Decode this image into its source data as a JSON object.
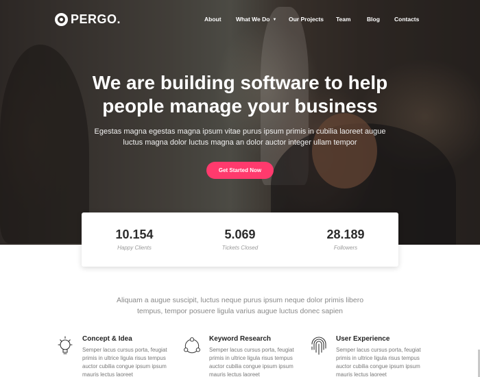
{
  "brand": {
    "name": "PERGO."
  },
  "nav": {
    "items": [
      {
        "label": "About"
      },
      {
        "label": "What We Do",
        "has_dropdown": true
      },
      {
        "label": "Our Projects"
      },
      {
        "label": "Team"
      },
      {
        "label": "Blog"
      },
      {
        "label": "Contacts"
      }
    ]
  },
  "hero": {
    "title_line1": "We are building software to help",
    "title_line2": "people manage your business",
    "subtitle_line1": "Egestas magna egestas magna ipsum vitae purus ipsum primis in cubilia laoreet augue",
    "subtitle_line2": "luctus magna dolor luctus magna an dolor auctor integer ullam tempor",
    "cta_label": "Get Started Now"
  },
  "stats": [
    {
      "value": "10.154",
      "label": "Happy Clients"
    },
    {
      "value": "5.069",
      "label": "Tickets Closed"
    },
    {
      "value": "28.189",
      "label": "Followers"
    }
  ],
  "intro": {
    "line1": "Aliquam a augue suscipit, luctus neque purus ipsum neque dolor primis libero",
    "line2": "tempus, tempor posuere ligula varius augue luctus donec sapien"
  },
  "features": [
    {
      "title": "Concept & Idea",
      "icon": "lightbulb-icon",
      "text": "Semper lacus cursus porta, feugiat primis in ultrice ligula risus tempus auctor cubilia congue ipsum ipsum mauris lectus laoreet"
    },
    {
      "title": "Keyword Research",
      "icon": "network-icon",
      "text": "Semper lacus cursus porta, feugiat primis in ultrice ligula risus tempus auctor cubilia congue ipsum ipsum mauris lectus laoreet"
    },
    {
      "title": "User Experience",
      "icon": "fingerprint-icon",
      "text": "Semper lacus cursus porta, feugiat primis in ultrice ligula risus tempus auctor cubilia congue ipsum ipsum mauris lectus laoreet"
    }
  ],
  "colors": {
    "accent": "#ff3a6d",
    "text_dark": "#2b2b2b",
    "text_muted": "#888888"
  }
}
